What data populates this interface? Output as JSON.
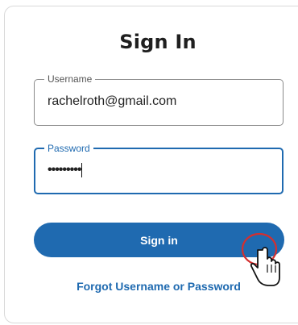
{
  "form": {
    "title": "Sign In",
    "username": {
      "label": "Username",
      "value": "rachelroth@gmail.com"
    },
    "password": {
      "label": "Password",
      "value": "•••••••••"
    },
    "submit_label": "Sign in",
    "forgot_link": "Forgot Username or Password"
  },
  "colors": {
    "accent": "#1f6ab0",
    "click_indicator": "#d32f2f"
  },
  "icons": {
    "cursor": "hand-pointer-cursor-icon"
  }
}
